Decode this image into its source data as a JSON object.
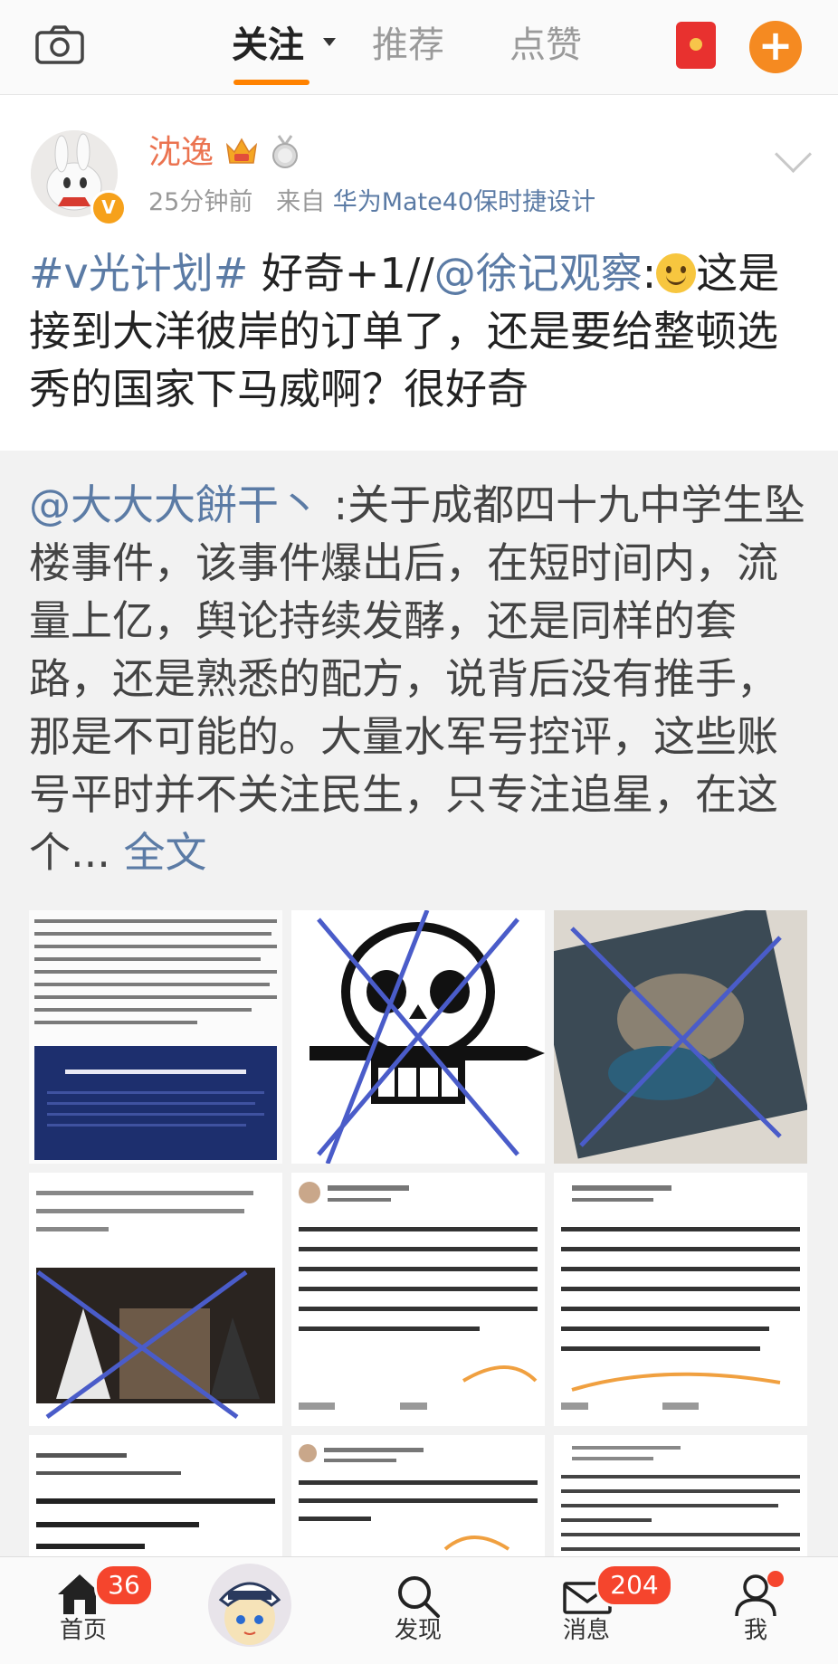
{
  "topnav": {
    "tabs": [
      "关注",
      "推荐",
      "点赞"
    ],
    "active_tab": "关注"
  },
  "post": {
    "username": "沈逸",
    "time": "25分钟前",
    "from_prefix": "来自",
    "source": "华为Mate40保时捷设计",
    "topic": "#v光计划#",
    "text_part1": " 好奇+1//",
    "mention": "@徐记观察",
    "text_part2": "这是接到大洋彼岸的订单了，还是要给整顿选秀的国家下马威啊？很好奇"
  },
  "retweet": {
    "mention": "@大大大餅干丶",
    "text": " :关于成都四十九中学生坠楼事件，该事件爆出后，在短时间内，流量上亿，舆论持续发酵，还是同样的套路，还是熟悉的配方，说背后没有推手，那是不可能的。大量水军号控评，这些账号平时并不关注民生，只专注追星，在这个... ",
    "more_link": "全文"
  },
  "images": [
    {
      "name": "news-screenshot"
    },
    {
      "name": "skull-drawing"
    },
    {
      "name": "blurred-photo"
    },
    {
      "name": "comment-screenshot-1"
    },
    {
      "name": "comment-screenshot-2"
    },
    {
      "name": "comment-screenshot-3"
    },
    {
      "name": "comment-screenshot-4"
    },
    {
      "name": "comment-screenshot-5"
    },
    {
      "name": "comment-screenshot-6"
    }
  ],
  "bottomnav": {
    "home_label": "首页",
    "home_badge": "36",
    "discover_label": "发现",
    "messages_label": "消息",
    "messages_badge": "204",
    "me_label": "我"
  },
  "colors": {
    "accent_orange": "#ff8200",
    "link_blue": "#5b7ba5",
    "username_orange": "#eb7350",
    "badge_red": "#f5452d"
  }
}
